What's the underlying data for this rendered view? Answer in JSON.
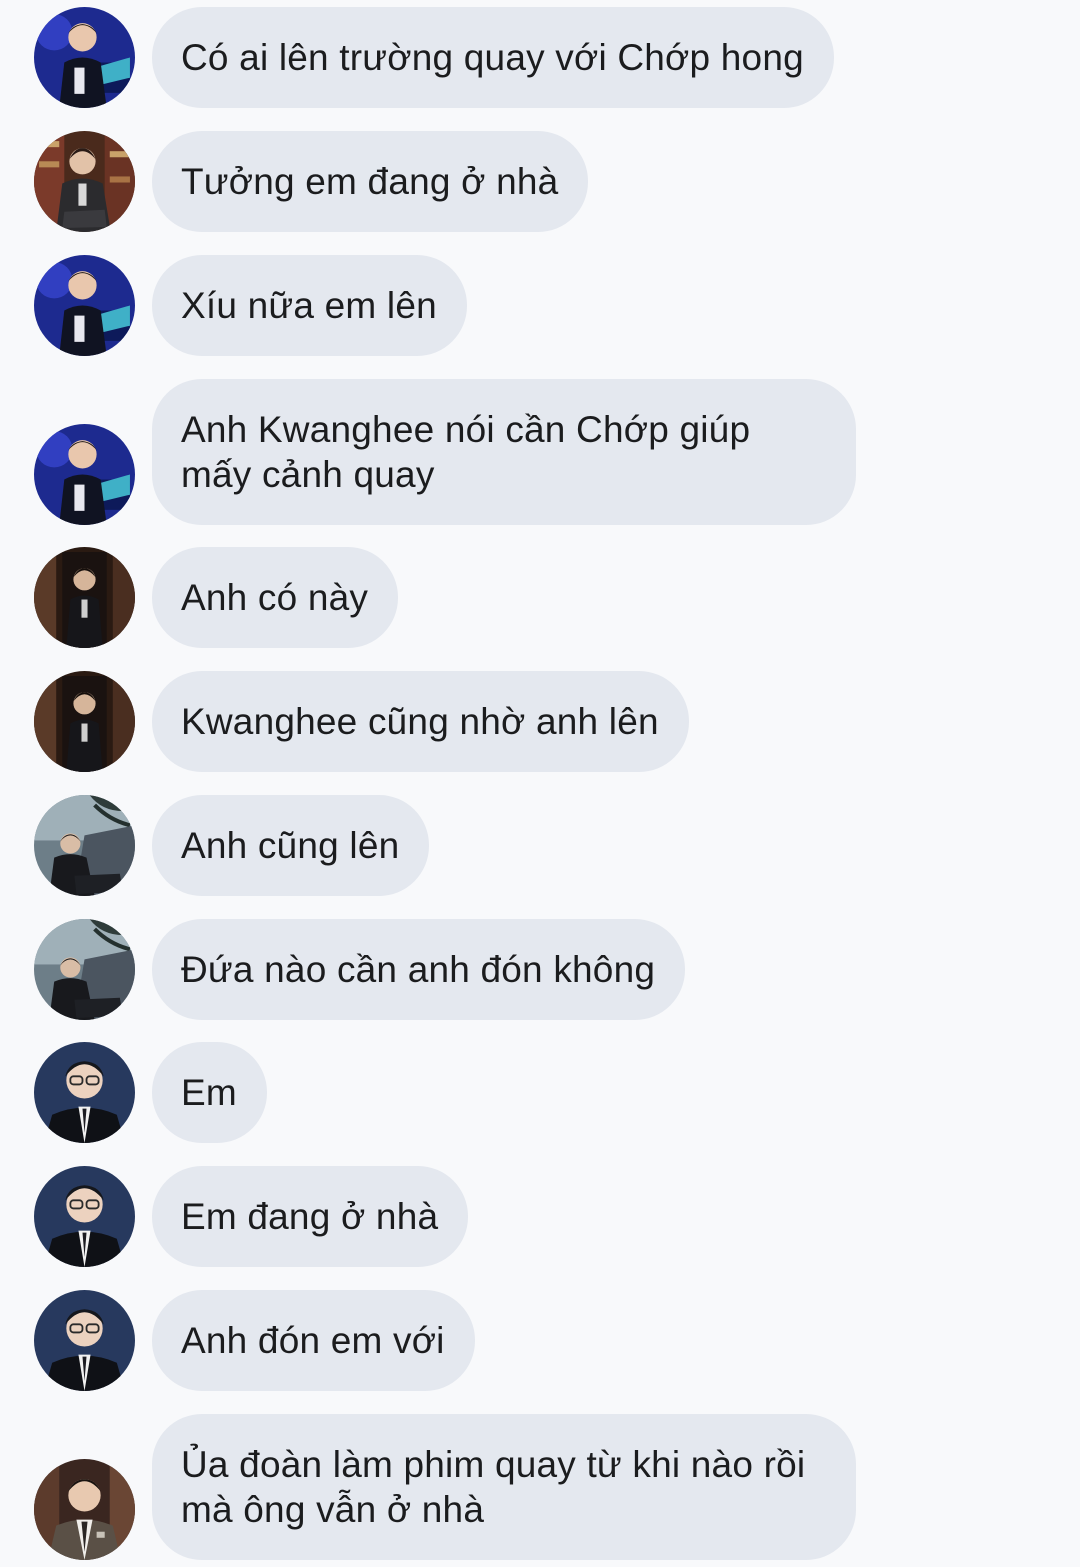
{
  "conversation": {
    "messages": [
      {
        "sender_icon": "avatar-stage-blue",
        "text": "Có ai lên trường quay với Chớp hong"
      },
      {
        "sender_icon": "avatar-suit-library",
        "text": "Tưởng em đang ở nhà"
      },
      {
        "sender_icon": "avatar-stage-blue",
        "text": "Xíu nữa em lên"
      },
      {
        "sender_icon": "avatar-stage-blue",
        "text": "Anh Kwanghee nói cần Chớp giúp mấy cảnh quay"
      },
      {
        "sender_icon": "avatar-dark-doorway",
        "text": "Anh có này"
      },
      {
        "sender_icon": "avatar-dark-doorway",
        "text": "Kwanghee cũng nhờ anh lên"
      },
      {
        "sender_icon": "avatar-rock-tree",
        "text": "Anh cũng lên"
      },
      {
        "sender_icon": "avatar-rock-tree",
        "text": "Đứa nào cần anh đón không"
      },
      {
        "sender_icon": "avatar-glasses-navy",
        "text": "Em"
      },
      {
        "sender_icon": "avatar-glasses-navy",
        "text": "Em đang ở nhà"
      },
      {
        "sender_icon": "avatar-glasses-navy",
        "text": "Anh đón em với"
      },
      {
        "sender_icon": "avatar-tie-warm",
        "text": "Ủa đoàn làm phim quay từ khi nào rồi mà ông vẫn ở nhà"
      }
    ]
  },
  "colors": {
    "background": "#f8f9fb",
    "bubble": "#e4e8ef",
    "text": "#1b1c1e"
  }
}
